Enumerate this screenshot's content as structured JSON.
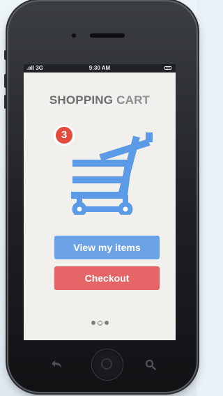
{
  "status_bar": {
    "signal": ".all 3G",
    "time": "9:30 AM"
  },
  "screen": {
    "title_word1": "SHOPPING",
    "title_word2": "CART",
    "cart_badge_count": "3",
    "view_items_label": "View my items",
    "checkout_label": "Checkout",
    "page_indicator": {
      "count": 3,
      "active_index": 1
    }
  },
  "icons": {
    "cart": "shopping-cart-icon",
    "back": "back-arrow-icon",
    "home": "home-button",
    "search": "search-icon"
  },
  "colors": {
    "cart_blue": "#5b9ae6",
    "badge_red": "#e34c3c",
    "view_button": "#6ca3e6",
    "checkout_button": "#e56566",
    "screen_bg": "#f1f0ec"
  }
}
